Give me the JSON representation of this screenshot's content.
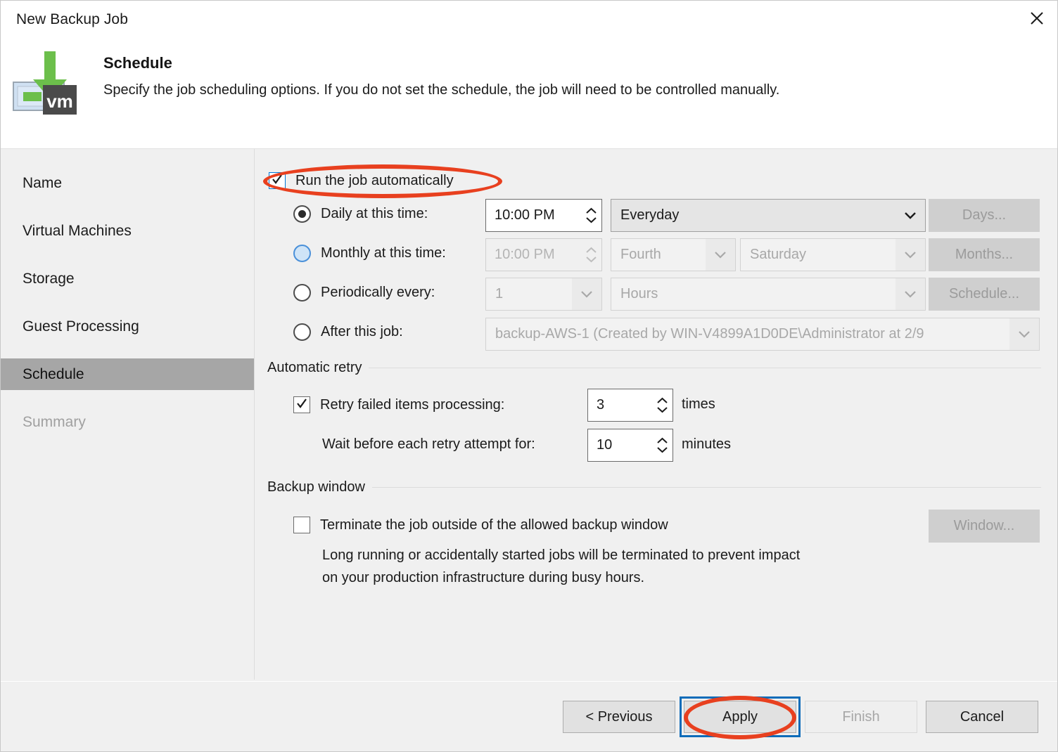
{
  "window": {
    "title": "New Backup Job",
    "close_icon": "close-icon"
  },
  "header": {
    "icon": "backup-vm-icon",
    "title": "Schedule",
    "description": "Specify the job scheduling options. If you do not set the schedule, the job will need to be controlled manually."
  },
  "sidebar": {
    "items": [
      {
        "label": "Name",
        "state": "normal"
      },
      {
        "label": "Virtual Machines",
        "state": "normal"
      },
      {
        "label": "Storage",
        "state": "normal"
      },
      {
        "label": "Guest Processing",
        "state": "normal"
      },
      {
        "label": "Schedule",
        "state": "selected"
      },
      {
        "label": "Summary",
        "state": "disabled"
      }
    ]
  },
  "schedule": {
    "run_automatically": {
      "label": "Run the job automatically",
      "checked": true
    },
    "daily": {
      "label": "Daily at this time:",
      "selected": true,
      "time": "10:00 PM",
      "frequency": "Everyday",
      "button": "Days..."
    },
    "monthly": {
      "label": "Monthly at this time:",
      "selected": false,
      "time": "10:00 PM",
      "week": "Fourth",
      "day": "Saturday",
      "button": "Months..."
    },
    "periodically": {
      "label": "Periodically every:",
      "selected": false,
      "count": "1",
      "unit": "Hours",
      "button": "Schedule..."
    },
    "after_job": {
      "label": "After this job:",
      "selected": false,
      "value": "backup-AWS-1 (Created by WIN-V4899A1D0DE\\Administrator at 2/9"
    }
  },
  "automatic_retry": {
    "group_label": "Automatic retry",
    "retry_failed": {
      "label": "Retry failed items processing:",
      "checked": true,
      "value": "3",
      "suffix": "times"
    },
    "wait_before": {
      "label": "Wait before each retry attempt for:",
      "value": "10",
      "suffix": "minutes"
    }
  },
  "backup_window": {
    "group_label": "Backup window",
    "terminate": {
      "label": "Terminate the job outside of the allowed backup window",
      "checked": false
    },
    "button": "Window...",
    "note_line1": "Long running or accidentally started jobs will be terminated to prevent impact",
    "note_line2": "on your production infrastructure during busy hours."
  },
  "footer": {
    "previous": "< Previous",
    "apply": "Apply",
    "finish": "Finish",
    "cancel": "Cancel",
    "finish_disabled": true
  },
  "annotations": {
    "accent_color": "#e8401f",
    "highlighted": [
      "run-the-job-automatically-checkbox",
      "apply-button"
    ]
  }
}
